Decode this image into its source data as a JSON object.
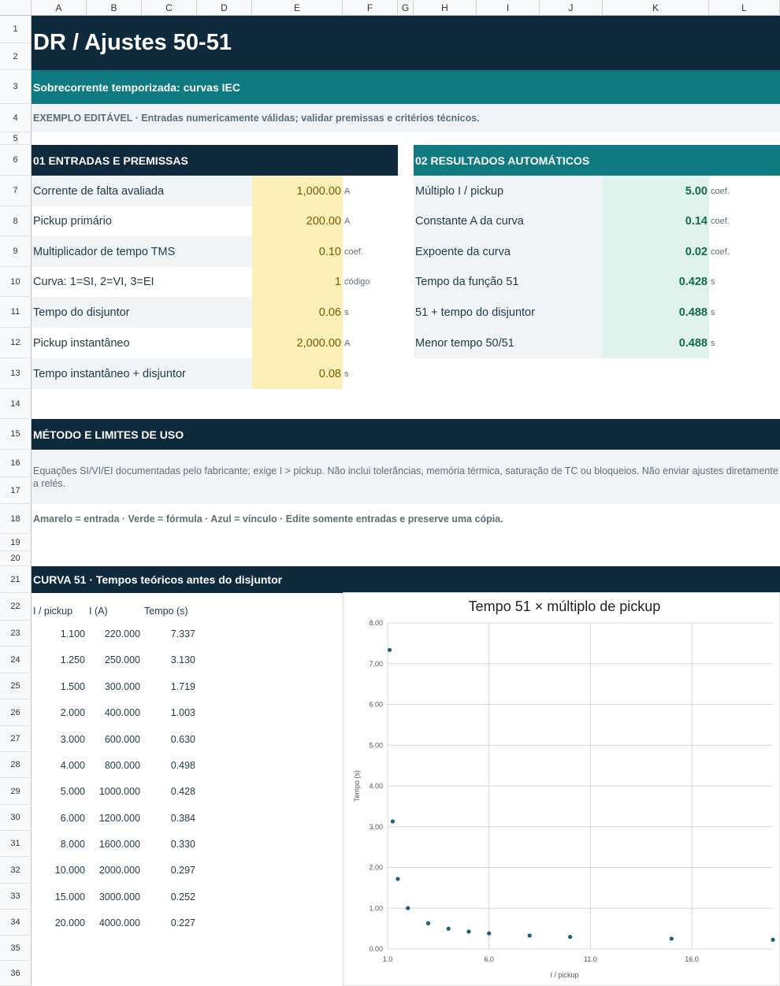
{
  "columns": [
    "A",
    "B",
    "C",
    "D",
    "E",
    "F",
    "G",
    "H",
    "I",
    "J",
    "K",
    "L"
  ],
  "rows": [
    "1",
    "2",
    "3",
    "4",
    "5",
    "6",
    "7",
    "8",
    "9",
    "10",
    "11",
    "12",
    "13",
    "14",
    "15",
    "16",
    "17",
    "18",
    "19",
    "20",
    "21",
    "22",
    "23",
    "24",
    "25",
    "26",
    "27",
    "28",
    "29",
    "30",
    "31",
    "32",
    "33",
    "34",
    "35",
    "36"
  ],
  "header": {
    "title": "DR  /  Ajustes 50-51",
    "subtitle": "Sobrecorrente temporizada: curvas IEC",
    "note": "EXEMPLO EDITÁVEL · Entradas numericamente válidas; validar premissas e critérios técnicos."
  },
  "inputs": {
    "title": "01  ENTRADAS E PREMISSAS",
    "items": [
      {
        "label": "Corrente de falta avaliada",
        "value": "1,000.00",
        "unit": "A"
      },
      {
        "label": "Pickup primário",
        "value": "200.00",
        "unit": "A"
      },
      {
        "label": "Multiplicador de tempo TMS",
        "value": "0.10",
        "unit": "coef."
      },
      {
        "label": "Curva: 1=SI, 2=VI, 3=EI",
        "value": "1",
        "unit": "código"
      },
      {
        "label": "Tempo do disjuntor",
        "value": "0.06",
        "unit": "s"
      },
      {
        "label": "Pickup instantâneo",
        "value": "2,000.00",
        "unit": "A"
      },
      {
        "label": "Tempo instantâneo + disjuntor",
        "value": "0.08",
        "unit": "s"
      }
    ]
  },
  "results": {
    "title": "02  RESULTADOS AUTOMÁTICOS",
    "items": [
      {
        "label": "Múltiplo I / pickup",
        "value": "5.00",
        "unit": "coef."
      },
      {
        "label": "Constante A da curva",
        "value": "0.14",
        "unit": "coef."
      },
      {
        "label": "Expoente da curva",
        "value": "0.02",
        "unit": "coef."
      },
      {
        "label": "Tempo da função 51",
        "value": "0.428",
        "unit": "s"
      },
      {
        "label": "51 + tempo do disjuntor",
        "value": "0.488",
        "unit": "s"
      },
      {
        "label": "Menor tempo 50/51",
        "value": "0.488",
        "unit": "s"
      }
    ]
  },
  "method": {
    "title": "MÉTODO E LIMITES DE USO",
    "text": "Equações SI/VI/EI documentadas pelo fabricante; exige I > pickup. Não inclui tolerâncias, memória térmica, saturação de TC ou bloqueios. Não enviar ajustes diretamente a relés.",
    "legend": "Amarelo = entrada · Verde = fórmula · Azul = vínculo · Edite somente entradas e preserve uma cópia."
  },
  "curve": {
    "title": "CURVA 51 · Tempos teóricos antes do disjuntor",
    "headers": [
      "I / pickup",
      "I (A)",
      "Tempo (s)"
    ],
    "rows": [
      [
        "1.100",
        "220.000",
        "7.337"
      ],
      [
        "1.250",
        "250.000",
        "3.130"
      ],
      [
        "1.500",
        "300.000",
        "1.719"
      ],
      [
        "2.000",
        "400.000",
        "1.003"
      ],
      [
        "3.000",
        "600.000",
        "0.630"
      ],
      [
        "4.000",
        "800.000",
        "0.498"
      ],
      [
        "5.000",
        "1000.000",
        "0.428"
      ],
      [
        "6.000",
        "1200.000",
        "0.384"
      ],
      [
        "8.000",
        "1600.000",
        "0.330"
      ],
      [
        "10.000",
        "2000.000",
        "0.297"
      ],
      [
        "15.000",
        "3000.000",
        "0.252"
      ],
      [
        "20.000",
        "4000.000",
        "0.227"
      ]
    ]
  },
  "colors": {
    "dark": "#0f2a3d",
    "teal": "#0f7b80",
    "input_fill": "#fcefb8",
    "result_fill": "#e0f2ec",
    "marker": "#1a5e80"
  },
  "chart_data": {
    "type": "scatter",
    "title": "Tempo 51 × múltiplo de pickup",
    "xlabel": "I / pickup",
    "ylabel": "Tempo (s)",
    "xlim": [
      1.0,
      20.0
    ],
    "ylim": [
      0.0,
      8.0
    ],
    "x_ticks": [
      "1.0",
      "6.0",
      "11.0",
      "16.0"
    ],
    "y_ticks": [
      "0.00",
      "1.00",
      "2.00",
      "3.00",
      "4.00",
      "5.00",
      "6.00",
      "7.00",
      "8.00"
    ],
    "grid": true,
    "series": [
      {
        "x": [
          1.1,
          1.25,
          1.5,
          2.0,
          3.0,
          4.0,
          5.0,
          6.0,
          8.0,
          10.0,
          15.0,
          20.0
        ],
        "y": [
          7.337,
          3.13,
          1.719,
          1.003,
          0.63,
          0.498,
          0.428,
          0.384,
          0.33,
          0.297,
          0.252,
          0.227
        ]
      }
    ]
  }
}
